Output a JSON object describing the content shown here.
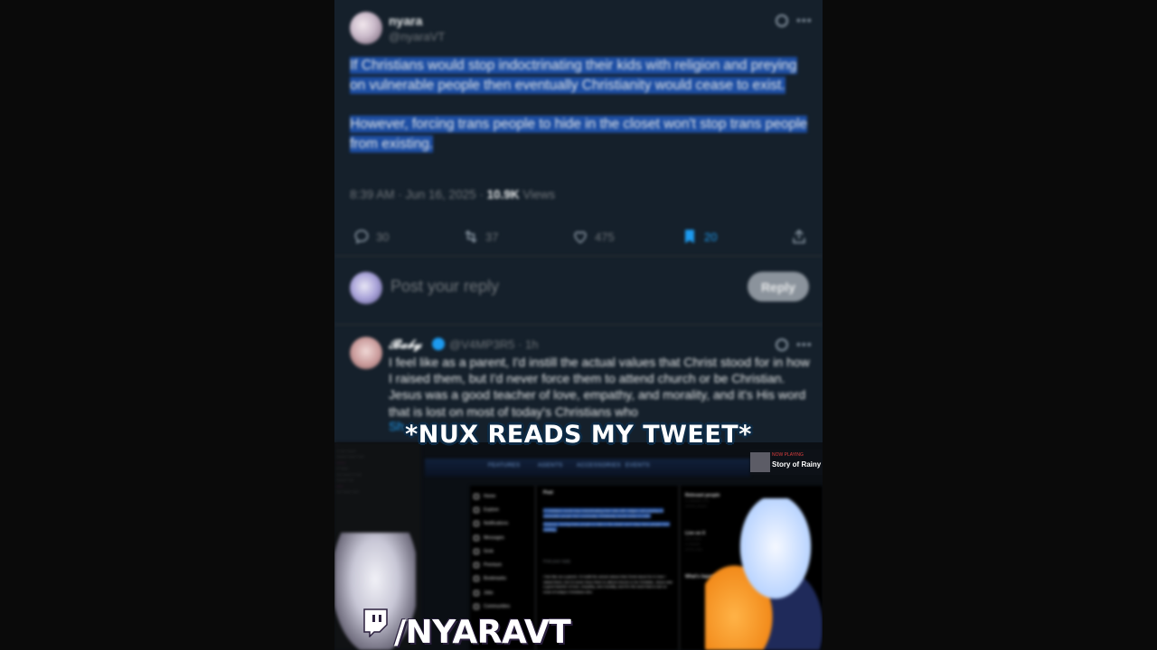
{
  "tweet": {
    "display_name": "nyara",
    "handle": "@nyaraVT",
    "paragraph_1": "If Christians would stop indoctrinating their kids with religion and preying on vulnerable people then eventually Christianity would cease to exist.",
    "paragraph_2": "However, forcing trans people to hide in the closet won't stop trans people from existing.",
    "timestamp": "8:39 AM · Jun 16, 2025 · ",
    "views_count": "10.9K",
    "views_label": " Views",
    "replies": "30",
    "reposts": "37",
    "likes": "475",
    "bookmarks": "20"
  },
  "reply_box": {
    "placeholder": "Post your reply",
    "button_label": "Reply"
  },
  "reply_tweet": {
    "display_name": "𝓑𝓪𝓫𝔂",
    "handle_time": "@V4MP3R5 · 1h",
    "text": "I feel like as a parent, I'd instill the actual values that Christ stood for in how I raised them, but I'd never force them to attend church or be Christian. Jesus was a good teacher of love, empathy, and morality, and it's His word that is lost on most of today's Christians who",
    "show_more": "Sh"
  },
  "caption": "*NUX READS MY TWEET*",
  "stream": {
    "tabs": [
      "FEATURES",
      "AGENTS",
      "ACCESSORIES",
      "EVENTS"
    ],
    "x_nav": [
      "Home",
      "Explore",
      "Notifications",
      "Messages",
      "Grok",
      "Premium",
      "Bookmarks",
      "Jobs",
      "Communities"
    ],
    "x_post_header": "Post",
    "side_headers": [
      "Relevant people",
      "Live on X",
      "What's happening"
    ],
    "now_playing_status": "NOW PLAYING",
    "now_playing_song": "Story of Rainy",
    "twitch_handle": "/NYARAVT"
  },
  "colors": {
    "background": "#15202b",
    "highlight": "#1d4ea3",
    "accent": "#1d9bf0"
  }
}
